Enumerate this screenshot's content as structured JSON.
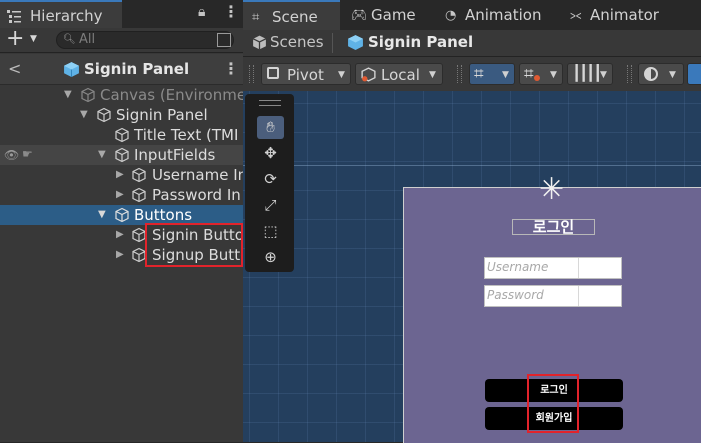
{
  "hierarchy": {
    "tab_label": "Hierarchy",
    "search_placeholder": "All",
    "prefab_title": "Signin Panel",
    "back_glyph": "<",
    "rows": [
      {
        "label": "Canvas (Environme"
      },
      {
        "label": "Signin Panel"
      },
      {
        "label": "Title Text (TMI"
      },
      {
        "label": "InputFields"
      },
      {
        "label": "Username In"
      },
      {
        "label": "Password In"
      },
      {
        "label": "Buttons"
      },
      {
        "label": "Signin Butto"
      },
      {
        "label": "Signup Butto"
      }
    ]
  },
  "scene_tabs": [
    {
      "label": "Scene",
      "icon": "grid-icon"
    },
    {
      "label": "Game",
      "icon": "gamepad-icon"
    },
    {
      "label": "Animation",
      "icon": "clock-icon"
    },
    {
      "label": "Animator",
      "icon": "animator-icon"
    }
  ],
  "breadcrumb": {
    "root": "Scenes",
    "current": "Signin Panel"
  },
  "toolbar": {
    "pivot_label": "Pivot",
    "space_label": "Local"
  },
  "canvas": {
    "title": "로그인",
    "username_placeholder": "Username",
    "password_placeholder": "Password",
    "signin_button": "로그인",
    "signup_button": "회원가입"
  },
  "colors": {
    "selection": "#2c5d87",
    "highlight_box": "#e2232b",
    "panel_bg": "#6c6591",
    "viewport_bg": "#243f5e"
  }
}
